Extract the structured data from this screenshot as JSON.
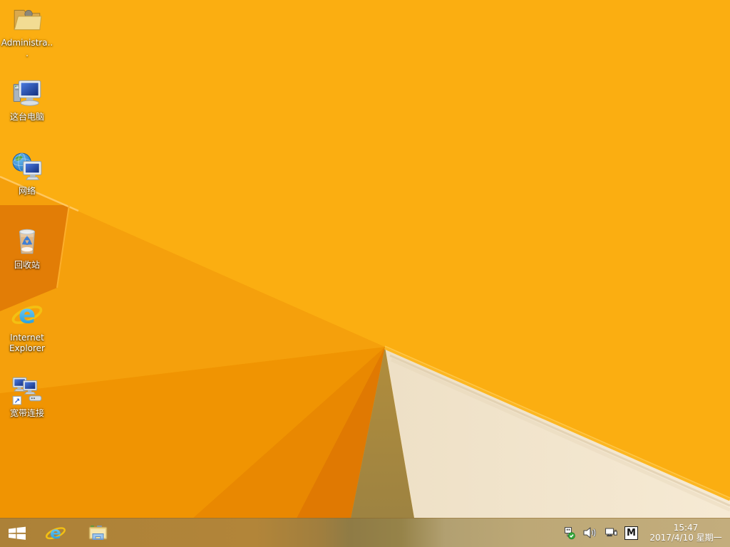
{
  "desktop": {
    "icons": [
      {
        "id": "administrator",
        "label": "Administra..."
      },
      {
        "id": "this-pc",
        "label": "这台电脑"
      },
      {
        "id": "network",
        "label": "网络"
      },
      {
        "id": "recycle-bin",
        "label": "回收站"
      },
      {
        "id": "internet-explorer",
        "label": "Internet Explorer"
      },
      {
        "id": "broadband",
        "label": "宽带连接"
      }
    ]
  },
  "taskbar": {
    "pinned": [
      {
        "id": "start",
        "icon": "windows-logo-icon"
      },
      {
        "id": "internet-explorer",
        "icon": "internet-explorer-icon"
      },
      {
        "id": "file-explorer",
        "icon": "file-explorer-icon"
      }
    ],
    "tray": {
      "icons": [
        "usb-safely-remove-icon",
        "volume-icon",
        "network-tray-icon"
      ],
      "ime_badge": "M",
      "time": "15:47",
      "date": "2017/4/10 星期一"
    }
  },
  "glyphs": {
    "ie_letter": "e",
    "shortcut_arrow": "↗"
  },
  "colors": {
    "wallpaper-base": "#fbae11",
    "facet1": "#f5a00c",
    "facet2": "#f09402",
    "facet3": "#e98801",
    "facet4": "#e07902",
    "box-face": "#e27d06",
    "shadow-facet": "#ab883c",
    "cream": "#f3e5cd",
    "bevel": "#fcb722",
    "taskbar-left": "#ac8138",
    "taskbar-right": "#c3ad7d",
    "label-color": "#ffffff"
  }
}
